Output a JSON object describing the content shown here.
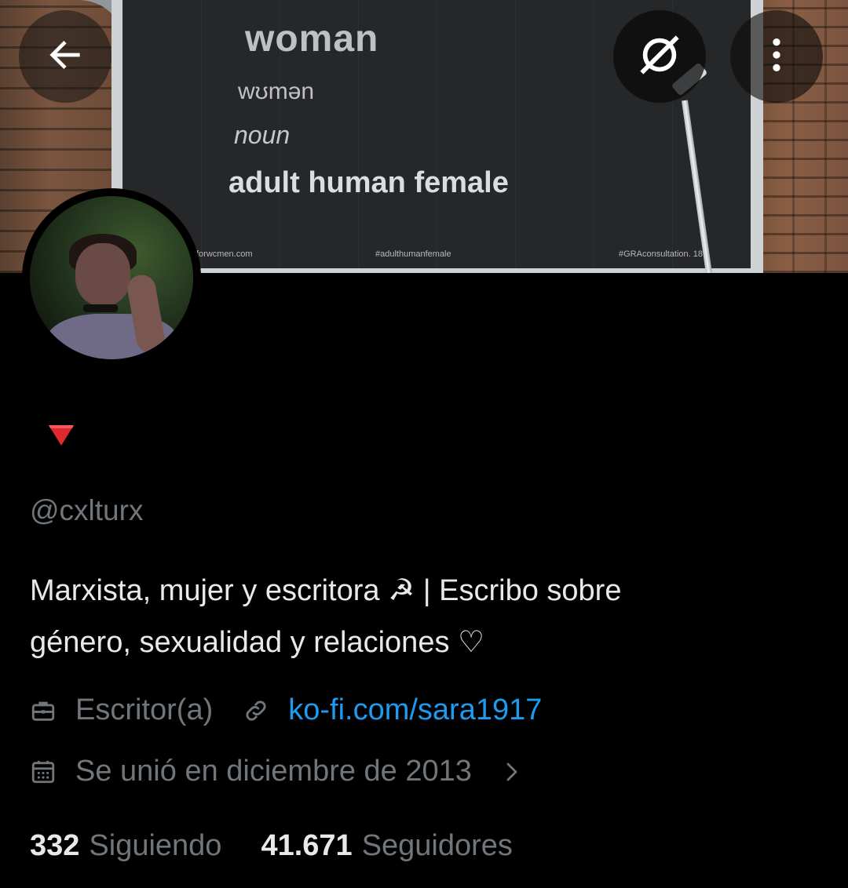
{
  "header": {
    "banner": {
      "word": "woman",
      "phonetic": "wʊmən",
      "part_of_speech": "noun",
      "definition": "adult human female",
      "footer_url": "forwcmen.com",
      "footer_tag1": "#adulthumanfemale",
      "footer_tag2": "#GRAconsultation. 18"
    },
    "back_icon": "arrow-left-icon",
    "hide_icon": "eye-off-icon",
    "more_icon": "more-vertical-icon"
  },
  "profile": {
    "display_flag": "🔻",
    "handle": "@cxlturx",
    "bio_line1": "Marxista, mujer y escritora ☭ | Escribo sobre",
    "bio_line2": "género, sexualidad y relaciones ♡",
    "profession": "Escritor(a)",
    "website": "ko-fi.com/sara1917",
    "joined": "Se unió en diciembre de 2013",
    "following_count": "332",
    "following_label": "Siguiendo",
    "followers_count": "41.671",
    "followers_label": "Seguidores"
  },
  "colors": {
    "background": "#000000",
    "text_primary": "#e7e9ea",
    "text_secondary": "#71767b",
    "link": "#1d9bf0",
    "flag_red": "#e0282e"
  }
}
